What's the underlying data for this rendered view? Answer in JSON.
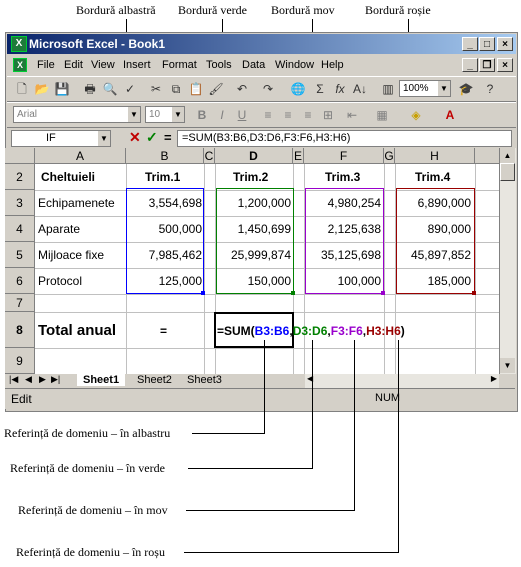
{
  "annotations": {
    "top": {
      "blue_border": "Bordură albastră",
      "green_border": "Bordură verde",
      "purple_border": "Bordură mov",
      "red_border": "Bordură roșie"
    },
    "bottom": {
      "blue_ref": "Referință de domeniu – în albastru",
      "green_ref": "Referință de domeniu – în verde",
      "purple_ref": "Referință de domeniu – în mov",
      "red_ref": "Referință de domeniu – în roșu"
    }
  },
  "window": {
    "title": "Microsoft Excel - Book1",
    "app_icon": "excel-icon"
  },
  "menu": [
    "File",
    "Edit",
    "View",
    "Insert",
    "Format",
    "Tools",
    "Data",
    "Window",
    "Help"
  ],
  "toolbar": {
    "font_name": "Arial",
    "font_size": "10",
    "zoom": "100%",
    "bold": "B",
    "italic": "I",
    "underline": "U"
  },
  "formula_bar": {
    "name_box": "IF",
    "cancel": "✕",
    "enter": "✓",
    "equals": "=",
    "content": "=SUM(B3:B6,D3:D6,F3:F6,H3:H6)"
  },
  "grid": {
    "columns": [
      "A",
      "B",
      "C",
      "D",
      "E",
      "F",
      "G",
      "H"
    ],
    "rows": [
      "2",
      "3",
      "4",
      "5",
      "6",
      "7",
      "8",
      "9"
    ],
    "header_row": [
      "Cheltuieli",
      "Trim.1",
      "Trim.2",
      "Trim.3",
      "Trim.4"
    ],
    "data": [
      {
        "label": "Echipamenete",
        "b": "3,554,698",
        "d": "1,200,000",
        "f": "4,980,254",
        "h": "6,890,000"
      },
      {
        "label": "Aparate",
        "b": "500,000",
        "d": "1,450,699",
        "f": "2,125,638",
        "h": "890,000"
      },
      {
        "label": "Mijloace fixe",
        "b": "7,985,462",
        "d": "25,999,874",
        "f": "35,125,698",
        "h": "45,897,852"
      },
      {
        "label": "Protocol",
        "b": "125,000",
        "d": "150,000",
        "f": "100,000",
        "h": "185,000"
      }
    ],
    "total_label": "Total anual",
    "total_eq": "=",
    "formula_parts": {
      "prefix": "=SUM(",
      "r1": "B3:B6",
      "c1": ",",
      "r2": "D3:D6",
      "c2": ",",
      "r3": "F3:F6",
      "c3": ",",
      "r4": "H3:H6",
      "suffix": ")"
    }
  },
  "sheet_tabs": [
    "Sheet1",
    "Sheet2",
    "Sheet3"
  ],
  "status": {
    "mode": "Edit",
    "num": "NUM"
  },
  "colors": {
    "blue": "#0000ff",
    "green": "#008000",
    "purple": "#9900cc",
    "red": "#990000",
    "title_start": "#0a246a",
    "title_end": "#a6caf0"
  }
}
